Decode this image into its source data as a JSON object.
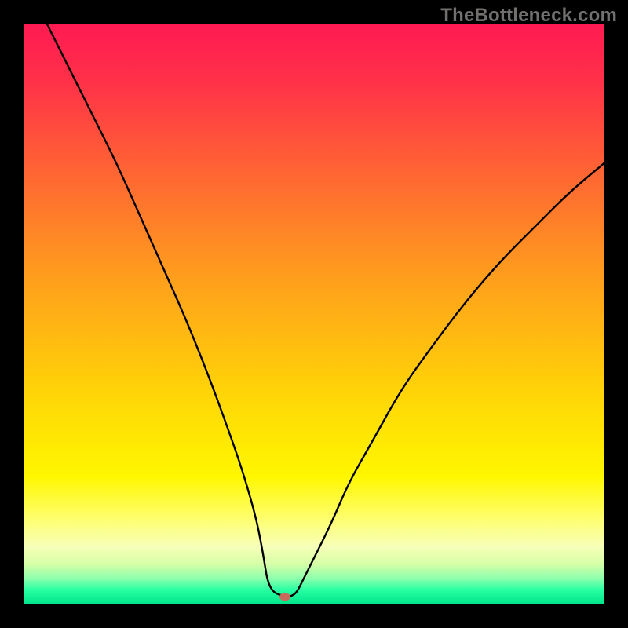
{
  "watermark": "TheBottleneck.com",
  "chart_data": {
    "type": "line",
    "title": "",
    "xlabel": "",
    "ylabel": "",
    "xlim": [
      0,
      100
    ],
    "ylim": [
      0,
      100
    ],
    "legend": false,
    "grid": false,
    "watermark_text": "TheBottleneck.com",
    "watermark_pos": "top-right",
    "background_gradient": {
      "direction": "vertical",
      "stops": [
        {
          "offset": 0.0,
          "color": "#ff1a52"
        },
        {
          "offset": 0.1,
          "color": "#ff3148"
        },
        {
          "offset": 0.25,
          "color": "#ff6334"
        },
        {
          "offset": 0.45,
          "color": "#ffa21b"
        },
        {
          "offset": 0.65,
          "color": "#ffd806"
        },
        {
          "offset": 0.78,
          "color": "#fff700"
        },
        {
          "offset": 0.86,
          "color": "#fdff7a"
        },
        {
          "offset": 0.9,
          "color": "#f7ffb8"
        },
        {
          "offset": 0.93,
          "color": "#d7ffa8"
        },
        {
          "offset": 0.955,
          "color": "#8dffac"
        },
        {
          "offset": 0.975,
          "color": "#28ffa3"
        },
        {
          "offset": 1.0,
          "color": "#00e48a"
        }
      ]
    },
    "series": [
      {
        "name": "bottleneck-curve",
        "color": "#000000",
        "x": [
          4,
          8,
          12,
          16,
          20,
          24,
          28,
          32,
          36,
          38,
          40,
          41,
          41.5,
          42,
          43,
          45,
          45.5,
          46,
          47,
          48,
          50,
          53,
          56,
          60,
          65,
          70,
          76,
          82,
          88,
          94,
          100
        ],
        "y": [
          100,
          92,
          84,
          76,
          67,
          58,
          49,
          39,
          28,
          22,
          15,
          10,
          7,
          4,
          2,
          1.4,
          1.35,
          1.4,
          2,
          4,
          8,
          14,
          21,
          28,
          37,
          44,
          52,
          59,
          65,
          71,
          76
        ]
      }
    ],
    "marker": {
      "name": "bottleneck-marker",
      "x": 45,
      "y": 1.3,
      "color": "#c76a5c",
      "rx": 7,
      "ry": 5
    }
  }
}
